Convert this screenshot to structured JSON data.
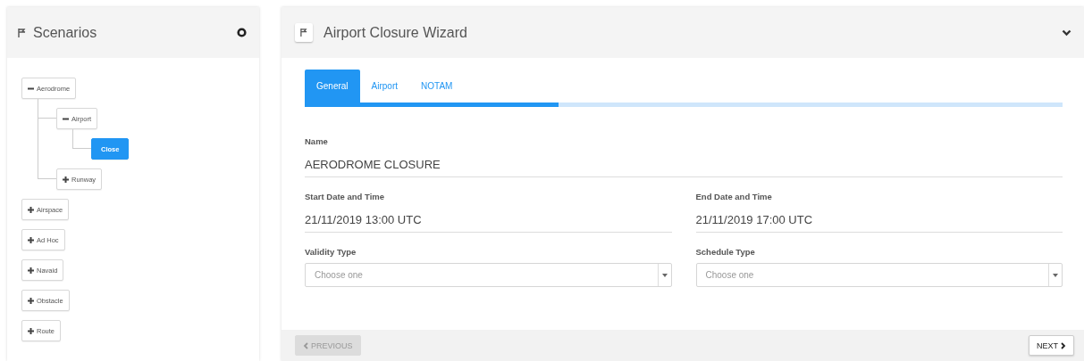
{
  "scenarios_panel": {
    "title": "Scenarios",
    "tree": [
      {
        "label": "Aerodrome",
        "expanded": true,
        "selected": false,
        "children": [
          {
            "label": "Airport",
            "expanded": true,
            "selected": false,
            "children": [
              {
                "label": "Close",
                "selected": true
              }
            ]
          },
          {
            "label": "Runway",
            "expanded": false,
            "selected": false
          }
        ]
      },
      {
        "label": "Airspace",
        "expanded": false,
        "selected": false
      },
      {
        "label": "Ad Hoc",
        "expanded": false,
        "selected": false
      },
      {
        "label": "Navaid",
        "expanded": false,
        "selected": false
      },
      {
        "label": "Obstacle",
        "expanded": false,
        "selected": false
      },
      {
        "label": "Route",
        "expanded": false,
        "selected": false
      }
    ]
  },
  "wizard": {
    "title": "Airport Closure Wizard",
    "tabs": [
      {
        "label": "General",
        "selected": true
      },
      {
        "label": "Airport",
        "selected": false
      },
      {
        "label": "NOTAM",
        "selected": false
      }
    ],
    "progress": {
      "level": 0.335
    },
    "fields": [
      {
        "kind": "text",
        "label": "Name",
        "value": "AERODROME CLOSURE"
      },
      {
        "kind": "date",
        "label": "Start Date and Time",
        "value": "21/11/2019 13:00 UTC"
      },
      {
        "kind": "date",
        "label": "End Date and Time",
        "value": "21/11/2019 17:00 UTC"
      },
      {
        "kind": "select",
        "label": "Validity Type",
        "placeholder": "Choose one"
      },
      {
        "kind": "select",
        "label": "Schedule Type",
        "placeholder": "Choose one"
      }
    ],
    "buttons": [
      {
        "kind": "previous",
        "label": "PREVIOUS",
        "disabled": true
      },
      {
        "kind": "next",
        "label": "NEXT",
        "disabled": false
      }
    ]
  }
}
